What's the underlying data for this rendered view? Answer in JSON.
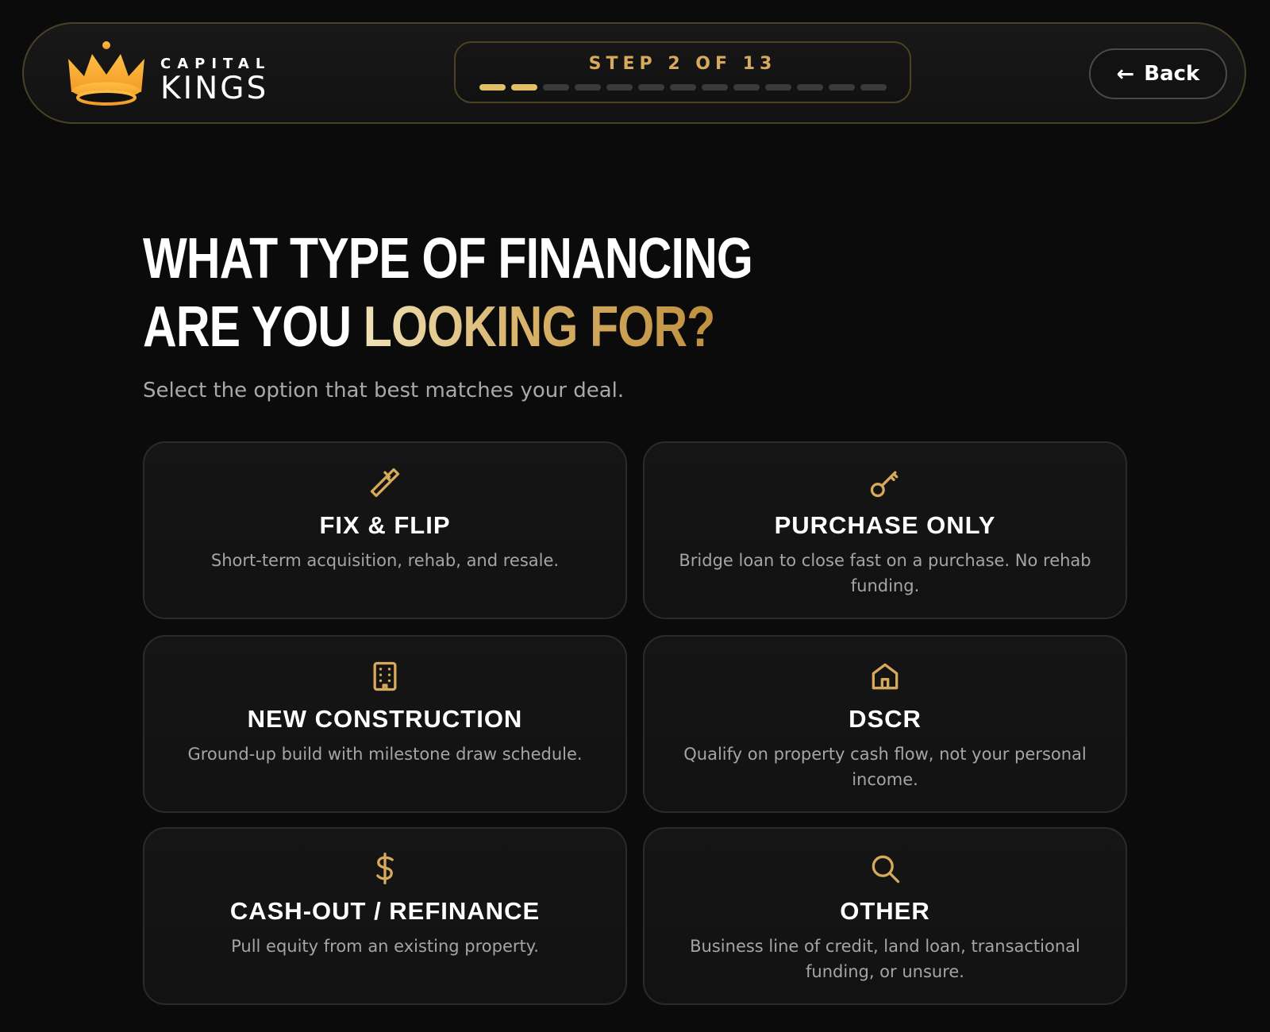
{
  "brand": {
    "top": "CAPITAL",
    "bottom": "KINGS",
    "logo_icon": "crown-icon",
    "accent": "#e0bf66"
  },
  "progress": {
    "label": "STEP 2 OF 13",
    "current": 2,
    "total": 13
  },
  "nav": {
    "back_label": "Back",
    "back_icon": "arrow-left-icon"
  },
  "page": {
    "title_line_1": "WHAT TYPE OF FINANCING",
    "title_line_2_prefix": "ARE YOU ",
    "title_line_2_accent": "LOOKING FOR?",
    "subtitle": "Select the option that best matches your deal."
  },
  "options": [
    {
      "id": "fix-flip",
      "title": "FIX & FLIP",
      "description": "Short-term acquisition, rehab, and resale.",
      "icon": "hammer-icon"
    },
    {
      "id": "purchase-only",
      "title": "PURCHASE ONLY",
      "description": "Bridge loan to close fast on a purchase. No rehab funding.",
      "icon": "key-icon"
    },
    {
      "id": "new-construction",
      "title": "NEW CONSTRUCTION",
      "description": "Ground-up build with milestone draw schedule.",
      "icon": "building-icon"
    },
    {
      "id": "dscr",
      "title": "DSCR",
      "description": "Qualify on property cash flow, not your personal income.",
      "icon": "house-icon"
    },
    {
      "id": "cash-out-refinance",
      "title": "CASH-OUT / REFINANCE",
      "description": "Pull equity from an existing property.",
      "icon": "dollar-icon"
    },
    {
      "id": "other",
      "title": "OTHER",
      "description": "Business line of credit, land loan, transactional funding, or unsure.",
      "icon": "search-icon"
    }
  ]
}
